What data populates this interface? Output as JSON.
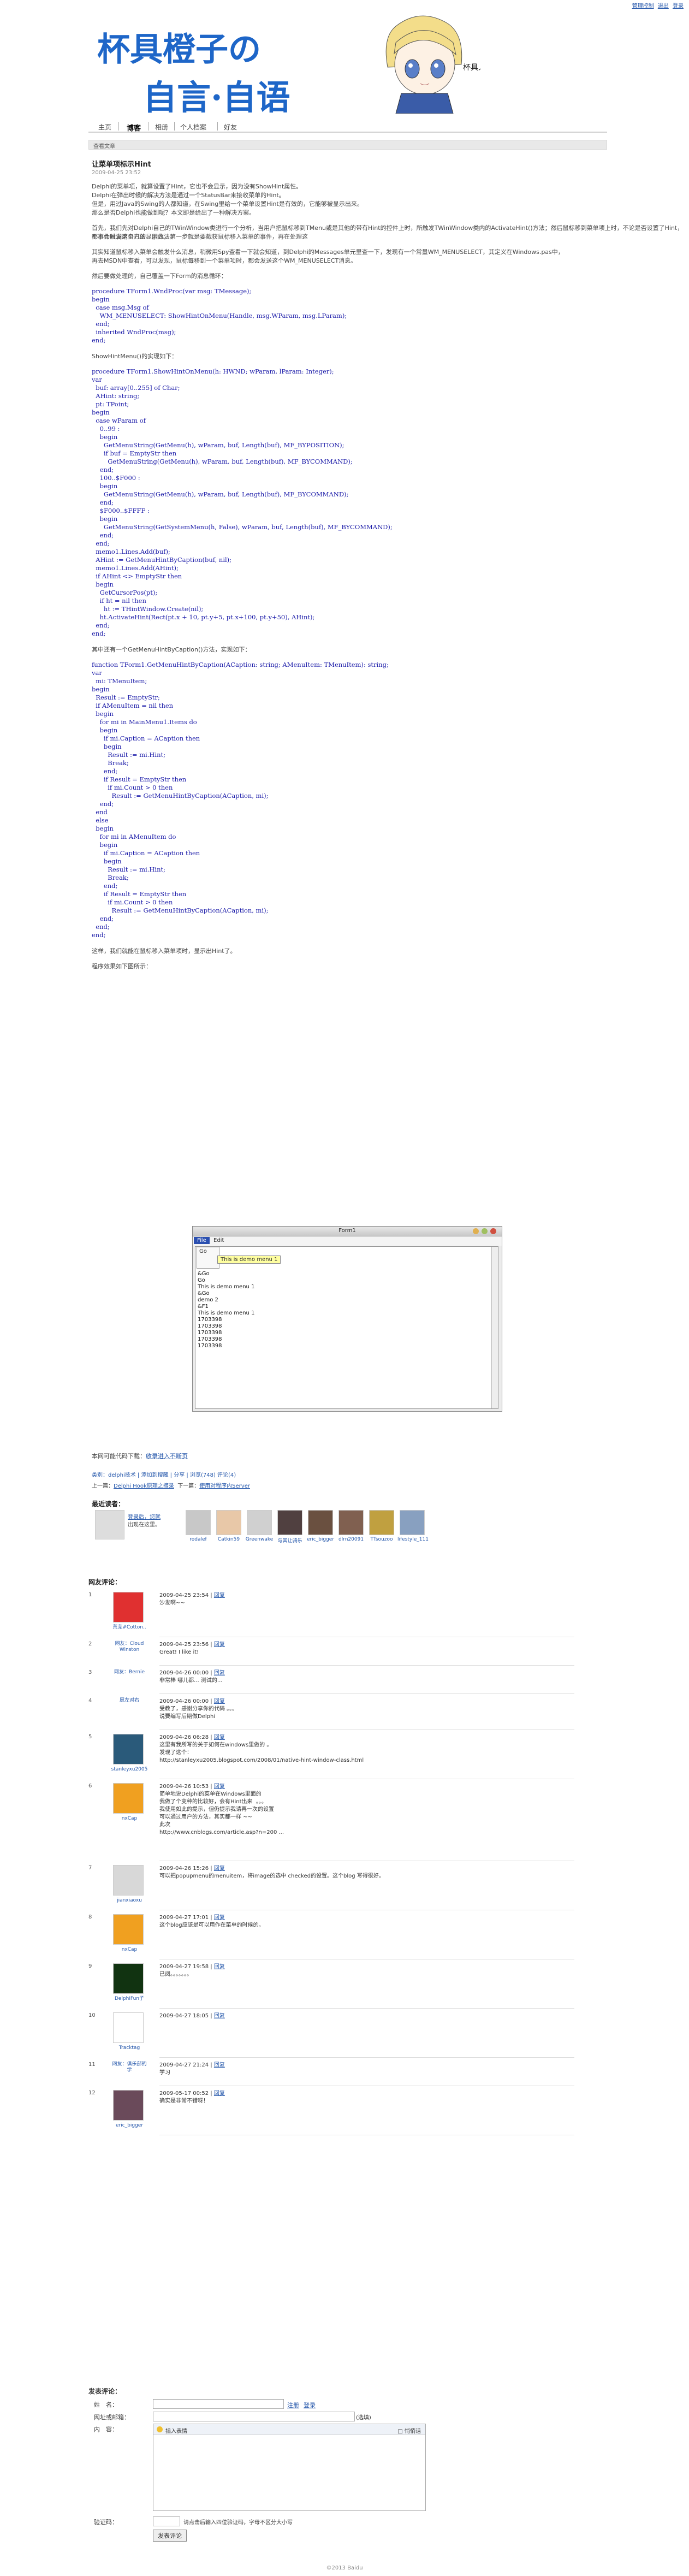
{
  "toplinks": [
    "管理控制",
    "退出",
    "登录"
  ],
  "header": {
    "title_line1": "杯具橙子の",
    "title_line2": "自言·自语",
    "sig": "杯具人"
  },
  "nav": [
    "主页",
    "博客",
    "相册",
    "个人档案",
    "好友"
  ],
  "bar1": "查看文章",
  "post": {
    "title": "让菜单项标示Hint",
    "date": "2009-04-25 23:52",
    "p1": [
      "Delphi的菜单项，就算设置了Hint，它也不会显示，因为没有ShowHint属性。",
      "Delphi在弹出时候的解决方法是通过一个StatusBar来接收菜单的Hint。",
      "但是，用过Java的Swing的人都知道，在Swing里给一个菜单设置Hint是有效的，它能够被显示出来。",
      "那么是否Delphi也能做到呢？本文即是给出了一种解决方案。"
    ],
    "p2": [
      "首先，我们先对Delphi自己的TWinWindow类进行一个分析，当用户把鼠标移到TMenu或是其他的带有Hint的控件上时，所触发TWinWindow类内的ActivateHint()方法；然后鼠标移到菜单项上时，不论是否设置了Hint，都不会触发这个方法。因此，第一步就是要截获鼠标移入菜单的事件，再在处理这",
      "个事件时调用自己的显示方法。"
    ],
    "p3": [
      "其实知道鼠标移入菜单会触发什么消息，稍微用Spy查看一下就会知道，到Delphi的Messages单元里查一下，发现有一个常量WM_MENUSELECT，其定义在Windows.pas中，",
      "再去MSDN中查看，可以发现，鼠标每移到一个菜单项时，都会发送这个WM_MENUSELECT消息。"
    ],
    "p4": "然后要做处理的，自己覆盖一下Form的消息循环：",
    "code1": [
      "procedure TForm1.WndProc(var msg: TMessage);",
      "begin",
      "  case msg.Msg of",
      "    WM_MENUSELECT: ShowHintOnMenu(Handle, msg.WParam, msg.LParam);",
      "  end;",
      "  inherited WndProc(msg);",
      "end;"
    ],
    "p5": "ShowHintMenu()的实现如下：",
    "code2": [
      "procedure TForm1.ShowHintOnMenu(h: HWND; wParam, lParam: Integer);",
      "var",
      "  buf: array[0..255] of Char;",
      "  AHint: string;",
      "  pt: TPoint;",
      "begin",
      "  case wParam of",
      "    0..99 :",
      "    begin",
      "      GetMenuString(GetMenu(h), wParam, buf, Length(buf), MF_BYPOSITION);",
      "      if buf = EmptyStr then",
      "        GetMenuString(GetMenu(h), wParam, buf, Length(buf), MF_BYCOMMAND);",
      "    end;",
      "    100..$F000 :",
      "    begin",
      "      GetMenuString(GetMenu(h), wParam, buf, Length(buf), MF_BYCOMMAND);",
      "    end;",
      "    $F000..$FFFF :",
      "    begin",
      "      GetMenuString(GetSystemMenu(h, False), wParam, buf, Length(buf), MF_BYCOMMAND);",
      "    end;",
      "  end;",
      "  memo1.Lines.Add(buf);",
      "  AHint := GetMenuHintByCaption(buf, nil);",
      "  memo1.Lines.Add(AHint);",
      "  if AHint <> EmptyStr then",
      "  begin",
      "    GetCursorPos(pt);",
      "    if ht = nil then",
      "      ht := THintWindow.Create(nil);",
      "    ht.ActivateHint(Rect(pt.x + 10, pt.y+5, pt.x+100, pt.y+50), AHint);",
      "  end;",
      "end;"
    ],
    "p6": "其中还有一个GetMenuHintByCaption()方法，实现如下：",
    "code3": [
      "function TForm1.GetMenuHintByCaption(ACaption: string; AMenuItem: TMenuItem): string;",
      "var",
      "  mi: TMenuItem;",
      "begin",
      "  Result := EmptyStr;",
      "  if AMenuItem = nil then",
      "  begin",
      "    for mi in MainMenu1.Items do",
      "    begin",
      "      if mi.Caption = ACaption then",
      "      begin",
      "        Result := mi.Hint;",
      "        Break;",
      "      end;",
      "      if Result = EmptyStr then",
      "        if mi.Count > 0 then",
      "          Result := GetMenuHintByCaption(ACaption, mi);",
      "    end;",
      "  end",
      "  else",
      "  begin",
      "    for mi in AMenuItem do",
      "    begin",
      "      if mi.Caption = ACaption then",
      "      begin",
      "        Result := mi.Hint;",
      "        Break;",
      "      end;",
      "      if Result = EmptyStr then",
      "        if mi.Count > 0 then",
      "          Result := GetMenuHintByCaption(ACaption, mi);",
      "    end;",
      "  end;",
      "end;"
    ],
    "p7": "这样，我们就能在鼠标移入菜单项时，显示出Hint了。",
    "p8": "程序效果如下图所示："
  },
  "shot": {
    "title": "Form1",
    "menu1": "File",
    "menu2": "Edit",
    "item": "Go",
    "hint": "This is demo menu 1",
    "memo": [
      "&Go",
      "Go",
      "This is demo menu 1",
      "&Go",
      "demo 2",
      "&F1",
      "This is demo menu 1",
      "1703398",
      "1703398",
      "1703398",
      "1703398",
      "1703398"
    ]
  },
  "share": {
    "text": "本网可能代码下载：",
    "link": "收录进入不断页"
  },
  "meta": {
    "cat": "类别：delphi技术",
    "links": [
      "添加到搜藏",
      "分享"
    ],
    "stats": "浏览(748) 评论(4)"
  },
  "prevnext": {
    "prev_label": "上一篇：",
    "prev": "Delphi Hook原理之摘录",
    "next_label": "下一篇：",
    "next": "使用对程序内Server"
  },
  "visitors_title": "最近读者：",
  "login_note": [
    "登录后，您就",
    "出现在这里。"
  ],
  "visitors": [
    "rodalef",
    "Catkin59",
    "Greenwake",
    "与其让骑乐",
    "eric_bigger",
    "dlrn20091",
    "TTsouzoo",
    "lifestyle_111"
  ],
  "comments_title": "网友评论：",
  "comments": [
    {
      "n": "1",
      "author": "荒芜#Cotton..",
      "date": "2009-04-25 23:54",
      "reply": "回复",
      "text": [
        "沙发啊~~"
      ]
    },
    {
      "n": "2",
      "author": "网友：Cloud Winston",
      "date": "2009-04-25 23:56",
      "reply": "回复",
      "text": [
        "Great! I like it!"
      ]
    },
    {
      "n": "3",
      "author": "网友：Bernie",
      "date": "2009-04-26 00:00",
      "reply": "回复",
      "text": [
        "非常棒 哪儿都... 测试的..."
      ]
    },
    {
      "n": "4",
      "author": "愿左对右",
      "date": "2009-04-26 00:00",
      "reply": "回复",
      "text": [
        "受教了，感谢分享你的代码 。。。",
        "说要编写后期做Delphi"
      ]
    },
    {
      "n": "5",
      "author": "stanleyxu2005",
      "date": "2009-04-26 06:28",
      "reply": "回复",
      "text": [
        "这里有我所写的关于如何在windows里做的 。",
        "发现了这个：",
        "http://stanleyxu2005.blogspot.com/2008/01/native-hint-window-class.html"
      ]
    },
    {
      "n": "6",
      "author": "nxCap",
      "date": "2009-04-26 10:53",
      "reply": "回复",
      "text": [
        "简单地说Delphi的菜单在Windows里面的",
        "我做了个变种的比较好，会有Hint出来  。。。",
        "",
        "我使用如此的提示，但仍提示我请再一次的设置",
        "可以通过用户的方法，其实都一样 ~~",
        "",
        "此次",
        "http://www.cnblogs.com/article.asp?n=200 ..."
      ]
    },
    {
      "n": "7",
      "author": "jianxiaoxu",
      "date": "2009-04-26 15:26",
      "reply": "回复",
      "text": [
        "可以把popupmenu的menuitem，将image的选中 checked的设置。这个blog 写得很好。"
      ]
    },
    {
      "n": "8",
      "author": "nxCap",
      "date": "2009-04-27 17:01",
      "reply": "回复",
      "text": [
        "这个blog应该是可以用作在菜单的时候的，"
      ]
    },
    {
      "n": "9",
      "author": "DelphiFun子",
      "date": "2009-04-27 19:58",
      "reply": "回复",
      "text": [
        "已阅。。。。。。。"
      ]
    },
    {
      "n": "10",
      "author": "Tracktag",
      "date": "2009-04-27 18:05",
      "reply": "回复",
      "text": [
        ""
      ]
    },
    {
      "n": "11",
      "author": "网友：俱乐部的学",
      "date": "2009-04-27 21:24",
      "reply": "回复",
      "text": [
        "学习"
      ]
    },
    {
      "n": "12",
      "author": "eric_bigger",
      "date": "2009-05-17 00:52",
      "reply": "回复",
      "text": [
        "确实是非常不错呀！"
      ]
    }
  ],
  "form": {
    "title": "发表评论：",
    "name_label": "姓　名：",
    "url_label": "网址或邮箱：",
    "url_hint": "(选填)",
    "content_label": "内　容：",
    "login": "注册",
    "register": "登录",
    "emoji": "插入表情",
    "check": "□ 悄悄话",
    "captcha_label": "验证码：",
    "captcha_hint": "请点击后输入四位验证码，字母不区分大小写",
    "submit": "发表评论"
  },
  "footer": "©2013 Baidu"
}
